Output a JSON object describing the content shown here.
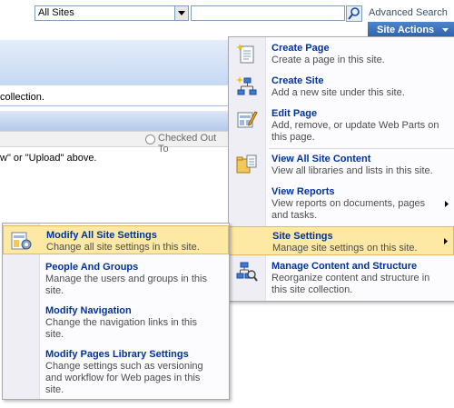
{
  "search": {
    "scope_value": "All Sites",
    "query_value": "",
    "advanced_search_label": "Advanced Search"
  },
  "page": {
    "collection_text": "collection.",
    "checked_out_label": "Checked Out To",
    "upload_text": "w\" or \"Upload\" above."
  },
  "site_actions": {
    "label": "Site Actions",
    "items": [
      {
        "title": "Create Page",
        "desc": "Create a page in this site.",
        "icon": "create-page-icon"
      },
      {
        "title": "Create Site",
        "desc": "Add a new site under this site.",
        "icon": "create-site-icon"
      },
      {
        "title": "Edit Page",
        "desc": "Add, remove, or update Web Parts on this page.",
        "icon": "edit-page-icon"
      },
      {
        "title": "View All Site Content",
        "desc": "View all libraries and lists in this site.",
        "icon": "site-content-icon"
      },
      {
        "title": "View Reports",
        "desc": "View reports on documents, pages and tasks.",
        "icon": "reports-icon",
        "submenu": true
      },
      {
        "title": "Site Settings",
        "desc": "Manage site settings on this site.",
        "icon": "settings-icon",
        "submenu": true,
        "highlighted": true
      },
      {
        "title": "Manage Content and Structure",
        "desc": "Reorganize content and structure in this site collection.",
        "icon": "manage-structure-icon"
      }
    ]
  },
  "site_settings_menu": {
    "items": [
      {
        "title": "Modify All Site Settings",
        "desc": "Change all site settings in this site.",
        "icon": "modify-settings-icon",
        "highlighted": true
      },
      {
        "title": "People And Groups",
        "desc": "Manage the users and groups in this site."
      },
      {
        "title": "Modify Navigation",
        "desc": "Change the navigation links in this site."
      },
      {
        "title": "Modify Pages Library Settings",
        "desc": "Change settings such as versioning and workflow for Web pages in this site."
      }
    ]
  },
  "colors": {
    "menu_title": "#003399",
    "highlight_bg": "#fde9a3",
    "site_actions_bg": "#2b60ac"
  }
}
